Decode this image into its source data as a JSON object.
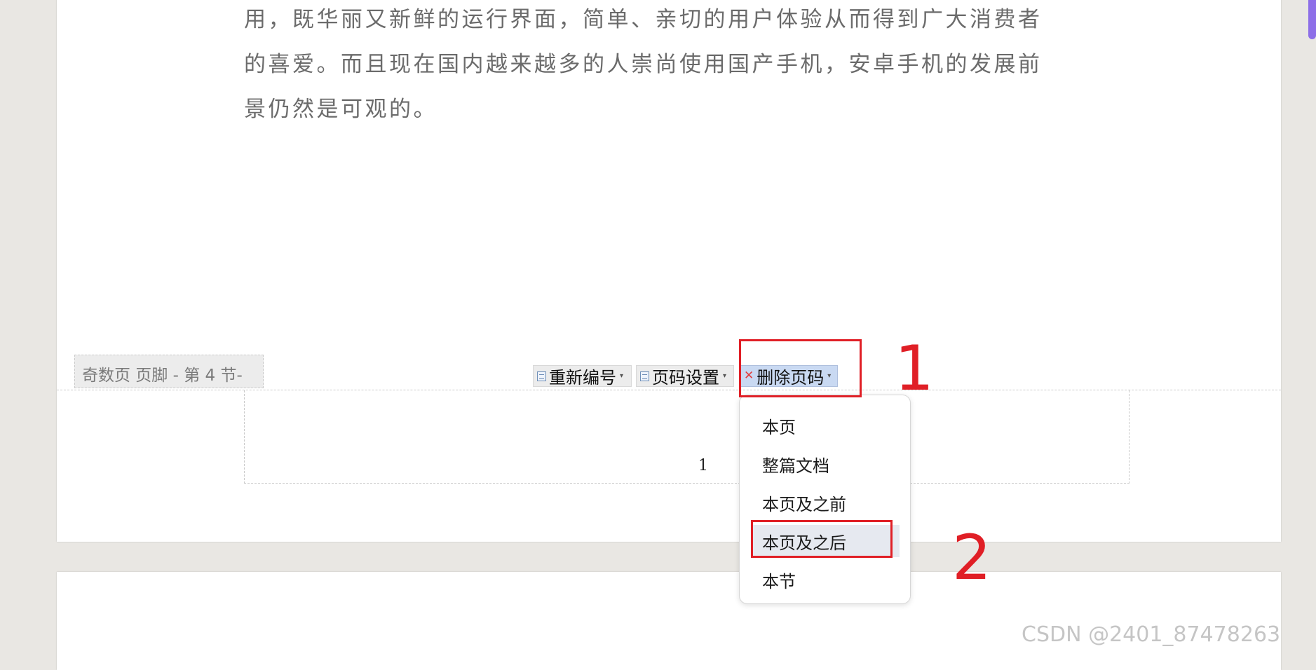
{
  "document": {
    "body_lines": [
      "用，既华丽又新鲜的运行界面，简单、亲切的用户体验从而得到广大消费者",
      "的喜爱。而且现在国内越来越多的人崇尚使用国产手机，安卓手机的发展前",
      "景仍然是可观的。"
    ],
    "footer_tag": "奇数页 页脚 - 第 4 节-",
    "page_number": "1"
  },
  "footer_toolbar": {
    "renumber_label": "重新编号",
    "page_setup_label": "页码设置",
    "delete_label": "删除页码"
  },
  "delete_menu": {
    "items": [
      "本页",
      "整篇文档",
      "本页及之前",
      "本页及之后",
      "本节"
    ],
    "highlighted": "本页及之后"
  },
  "annotations": {
    "step1": "1",
    "step2": "2",
    "color": "#e01f26"
  },
  "watermark": "CSDN @2401_87478263"
}
